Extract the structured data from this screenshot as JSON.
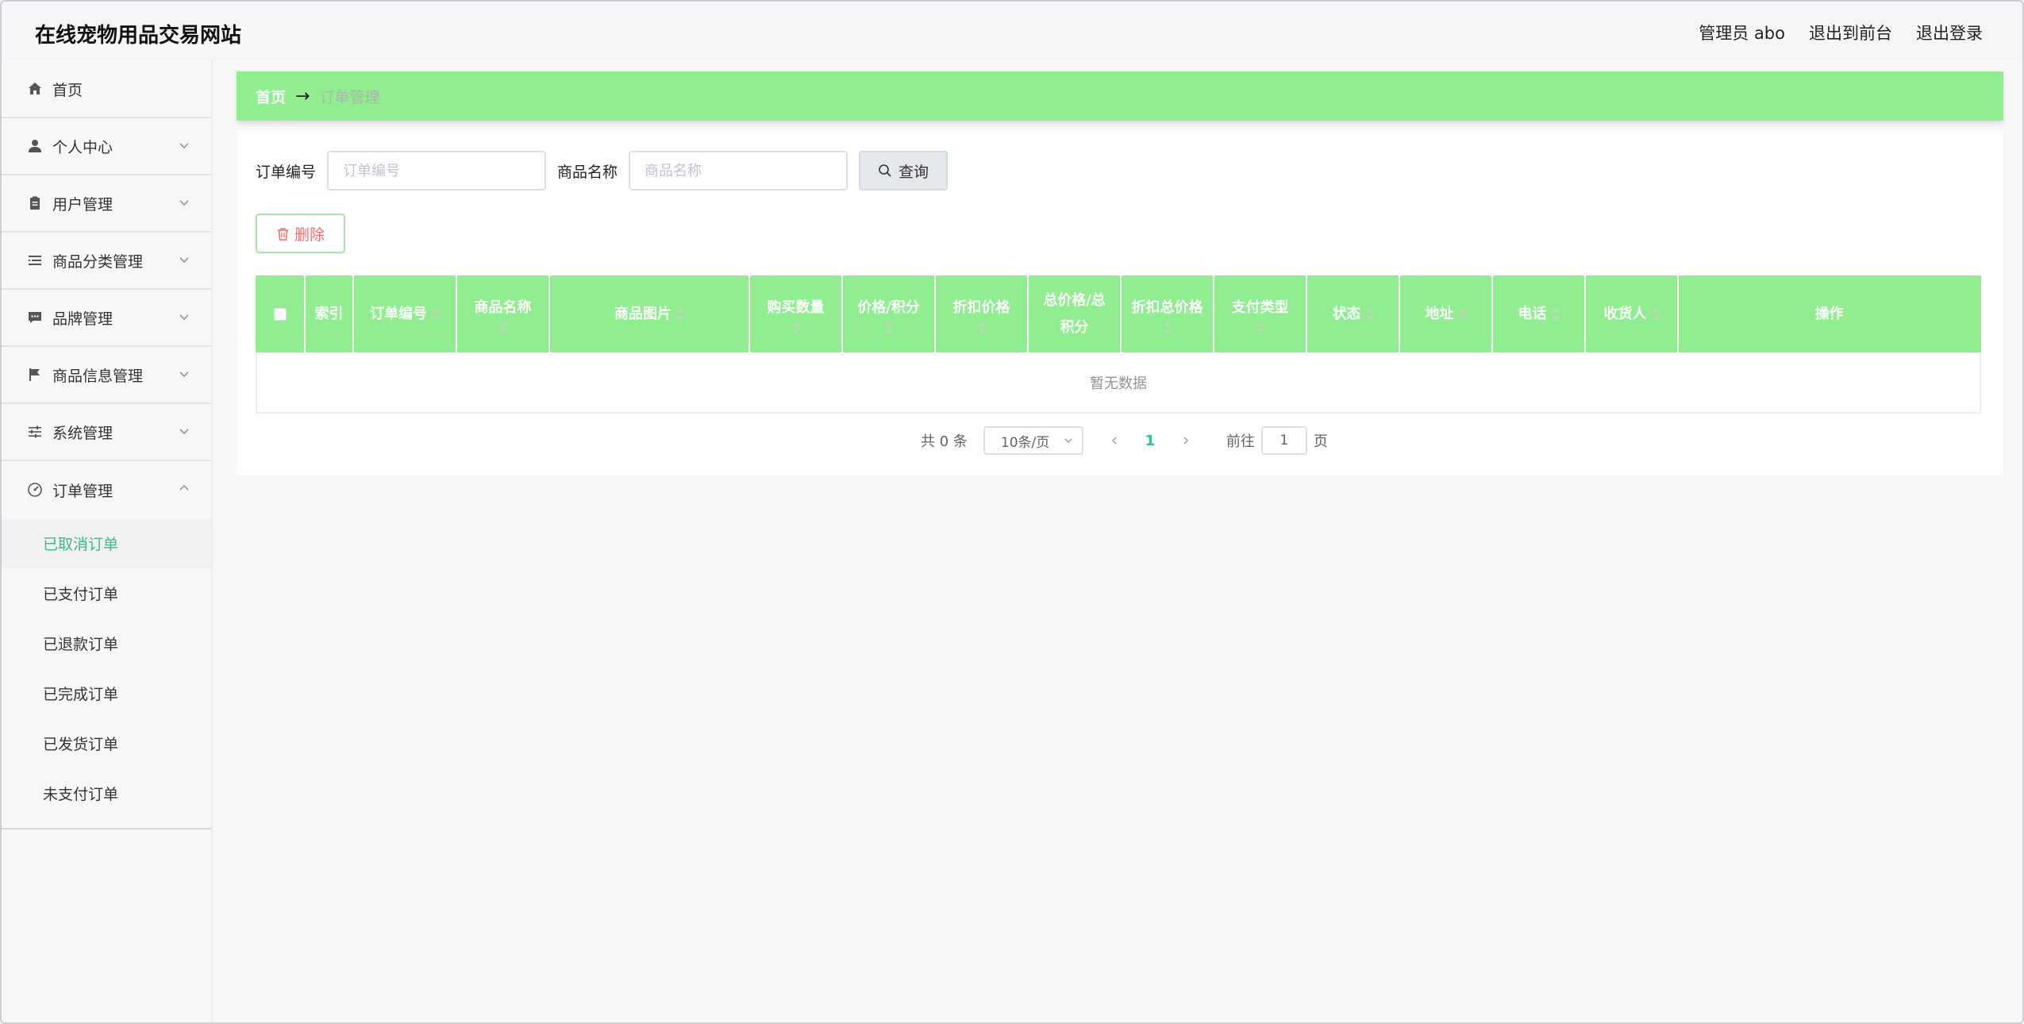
{
  "header": {
    "site_title": "在线宠物用品交易网站",
    "admin_label": "管理员 abo",
    "to_front": "退出到前台",
    "logout": "退出登录"
  },
  "sidebar": {
    "items": [
      {
        "label": "首页",
        "icon": "home-icon"
      },
      {
        "label": "个人中心",
        "icon": "user-icon"
      },
      {
        "label": "用户管理",
        "icon": "clipboard-icon"
      },
      {
        "label": "商品分类管理",
        "icon": "list-icon"
      },
      {
        "label": "品牌管理",
        "icon": "chat-icon"
      },
      {
        "label": "商品信息管理",
        "icon": "flag-icon"
      },
      {
        "label": "系统管理",
        "icon": "sliders-icon"
      },
      {
        "label": "订单管理",
        "icon": "gauge-icon"
      }
    ],
    "sub_items": [
      "已取消订单",
      "已支付订单",
      "已退款订单",
      "已完成订单",
      "已发货订单",
      "未支付订单"
    ],
    "active_color": "#3db88b"
  },
  "breadcrumb": {
    "home": "首页",
    "separator": "→",
    "current": "订单管理"
  },
  "search": {
    "order_no_label": "订单编号",
    "order_no_placeholder": "订单编号",
    "product_name_label": "商品名称",
    "product_name_placeholder": "商品名称",
    "query_label": "查询"
  },
  "actions": {
    "delete_label": "删除"
  },
  "table": {
    "header_color": "#90ee90",
    "columns": [
      {
        "label": ""
      },
      {
        "label": "索引"
      },
      {
        "label": "订单编号"
      },
      {
        "label": "商品名称"
      },
      {
        "label": "商品图片"
      },
      {
        "label": "购买数量"
      },
      {
        "label": "价格/积分"
      },
      {
        "label": "折扣价格"
      },
      {
        "label": "总价格/总积分"
      },
      {
        "label": "折扣总价格"
      },
      {
        "label": "支付类型"
      },
      {
        "label": "状态"
      },
      {
        "label": "地址"
      },
      {
        "label": "电话"
      },
      {
        "label": "收货人"
      },
      {
        "label": "操作"
      }
    ],
    "empty_text": "暂无数据"
  },
  "pagination": {
    "total_text": "共 0 条",
    "page_size": "10条/页",
    "current_page": "1",
    "goto_label": "前往",
    "goto_value": "1",
    "page_suffix": "页"
  }
}
